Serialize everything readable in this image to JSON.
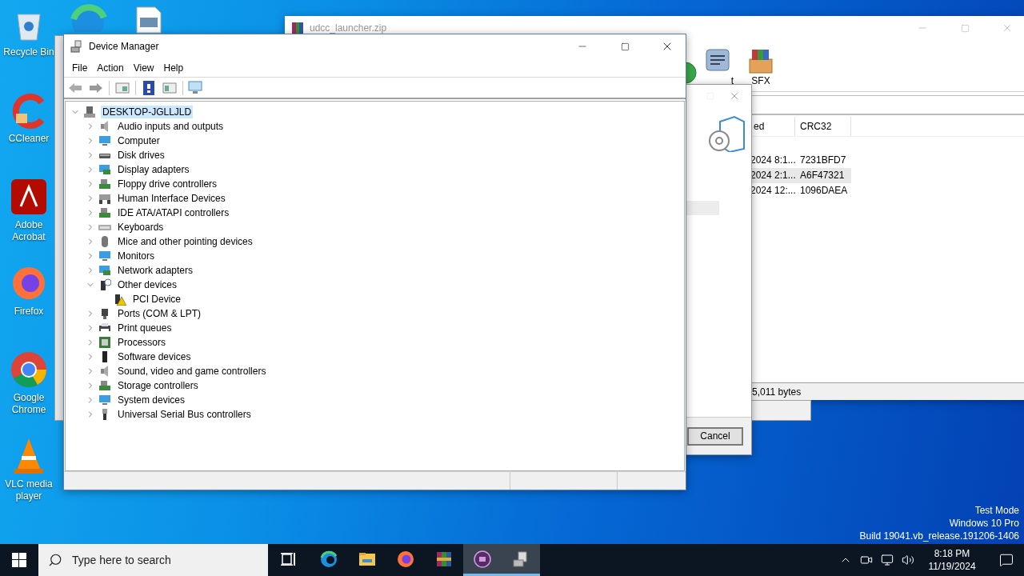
{
  "desktop_icons": [
    {
      "kind": "recycle-bin",
      "label": "Recycle Bin"
    },
    {
      "kind": "ccleaner",
      "label": "CCleaner"
    },
    {
      "kind": "acrobat",
      "label": "Adobe Acrobat"
    },
    {
      "kind": "firefox",
      "label": "Firefox"
    },
    {
      "kind": "chrome",
      "label": "Google Chrome"
    },
    {
      "kind": "vlc",
      "label": "VLC media player"
    }
  ],
  "archive_window": {
    "title": "udcc_launcher.zip",
    "tools": [
      {
        "kind": "info",
        "label": "t"
      },
      {
        "kind": "sfx",
        "label": "SFX"
      }
    ],
    "columns": [
      "ed",
      "CRC32"
    ],
    "rows": [
      {
        "modified": "2024 8:1...",
        "crc": "7231BFD7",
        "selected": false
      },
      {
        "modified": "2024 2:1...",
        "crc": "A6F47321",
        "selected": true
      },
      {
        "modified": "2024 12:...",
        "crc": "1096DAEA",
        "selected": false
      }
    ],
    "status": "5,011 bytes"
  },
  "extract_dialog": {
    "button": "Cancel"
  },
  "device_manager": {
    "title": "Device Manager",
    "menu": [
      "File",
      "Action",
      "View",
      "Help"
    ],
    "tree": {
      "label": "DESKTOP-JGLLJLD",
      "kind": "pc",
      "expanded": true,
      "selected": true,
      "children": [
        {
          "label": "Audio inputs and outputs",
          "kind": "speaker",
          "expanded": false,
          "selected": false
        },
        {
          "label": "Computer",
          "kind": "monitor",
          "expanded": false,
          "selected": false
        },
        {
          "label": "Disk drives",
          "kind": "disk",
          "expanded": false,
          "selected": false
        },
        {
          "label": "Display adapters",
          "kind": "display",
          "expanded": false,
          "selected": false
        },
        {
          "label": "Floppy drive controllers",
          "kind": "board",
          "expanded": false,
          "selected": false
        },
        {
          "label": "Human Interface Devices",
          "kind": "hid",
          "expanded": false,
          "selected": false
        },
        {
          "label": "IDE ATA/ATAPI controllers",
          "kind": "board",
          "expanded": false,
          "selected": false
        },
        {
          "label": "Keyboards",
          "kind": "keyboard",
          "expanded": false,
          "selected": false
        },
        {
          "label": "Mice and other pointing devices",
          "kind": "mouse",
          "expanded": false,
          "selected": false
        },
        {
          "label": "Monitors",
          "kind": "monitor",
          "expanded": false,
          "selected": false
        },
        {
          "label": "Network adapters",
          "kind": "display",
          "expanded": false,
          "selected": false
        },
        {
          "label": "Other devices",
          "kind": "unknown",
          "expanded": true,
          "selected": false,
          "children": [
            {
              "label": "PCI Device",
              "kind": "warning",
              "selected": false
            }
          ]
        },
        {
          "label": "Ports (COM & LPT)",
          "kind": "port",
          "expanded": false,
          "selected": false
        },
        {
          "label": "Print queues",
          "kind": "printer",
          "expanded": false,
          "selected": false
        },
        {
          "label": "Processors",
          "kind": "chip",
          "expanded": false,
          "selected": false
        },
        {
          "label": "Software devices",
          "kind": "tower",
          "expanded": false,
          "selected": false
        },
        {
          "label": "Sound, video and game controllers",
          "kind": "speaker",
          "expanded": false,
          "selected": false
        },
        {
          "label": "Storage controllers",
          "kind": "board",
          "expanded": false,
          "selected": false
        },
        {
          "label": "System devices",
          "kind": "monitor",
          "expanded": false,
          "selected": false
        },
        {
          "label": "Universal Serial Bus controllers",
          "kind": "usb",
          "expanded": false,
          "selected": false
        }
      ]
    }
  },
  "system_info": [
    "Test Mode",
    "Windows 10 Pro",
    "Build 19041.vb_release.191206-1406"
  ],
  "taskbar": {
    "search_placeholder": "Type here to search",
    "apps": [
      {
        "kind": "edge",
        "active": false
      },
      {
        "kind": "explorer",
        "active": false
      },
      {
        "kind": "firefox",
        "active": false
      },
      {
        "kind": "winrar",
        "active": false
      },
      {
        "kind": "media-app",
        "active": true
      },
      {
        "kind": "device-manager",
        "active": true
      }
    ],
    "time": "8:18 PM",
    "date": "11/19/2024"
  }
}
